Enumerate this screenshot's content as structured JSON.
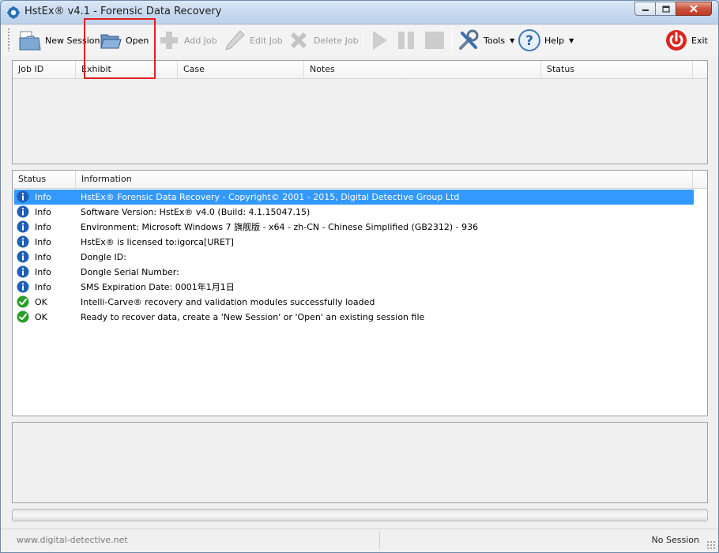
{
  "window": {
    "title": "HstEx® v4.1 - Forensic Data Recovery"
  },
  "toolbar": {
    "new_session": "New Session",
    "open": "Open",
    "add_job": "Add Job",
    "edit_job": "Edit Job",
    "delete_job": "Delete Job",
    "tools": "Tools",
    "help": "Help",
    "exit": "Exit"
  },
  "jobs_table": {
    "columns": [
      "Job ID",
      "Exhibit",
      "Case",
      "Notes",
      "Status"
    ]
  },
  "log_table": {
    "columns": [
      "Status",
      "Information"
    ],
    "rows": [
      {
        "status": "Info",
        "kind": "info",
        "text": "HstEx® Forensic Data Recovery - Copyright© 2001 - 2015, Digital Detective Group Ltd"
      },
      {
        "status": "Info",
        "kind": "info",
        "text": "Software Version: HstEx® v4.0 (Build: 4.1.15047.15)"
      },
      {
        "status": "Info",
        "kind": "info",
        "text": "Environment: Microsoft Windows 7 旗舰版 - x64 - zh-CN - Chinese Simplified (GB2312) - 936"
      },
      {
        "status": "Info",
        "kind": "info",
        "text": "HstEx® is licensed to:igorca[URET]"
      },
      {
        "status": "Info",
        "kind": "info",
        "text": "Dongle ID:"
      },
      {
        "status": "Info",
        "kind": "info",
        "text": "Dongle Serial Number:"
      },
      {
        "status": "Info",
        "kind": "info",
        "text": "SMS Expiration Date: 0001年1月1日"
      },
      {
        "status": "OK",
        "kind": "ok",
        "text": "Intelli-Carve® recovery and validation modules successfully loaded"
      },
      {
        "status": "OK",
        "kind": "ok",
        "text": "Ready to recover data, create a 'New Session' or 'Open' an existing session file"
      }
    ]
  },
  "progress": {
    "value": 0
  },
  "statusbar": {
    "website": "www.digital-detective.net",
    "session": "No Session"
  },
  "colors": {
    "selection": "#3399ff",
    "info_icon": "#1f5fb8",
    "ok_icon": "#2a9d2a",
    "exit_icon": "#d9261c",
    "highlight": "#e02020"
  },
  "icons": {
    "app": "gear-icon",
    "new_session": "new-session-icon",
    "open": "open-folder-icon",
    "add_job": "plus-icon",
    "edit_job": "pencil-icon",
    "delete_job": "x-icon",
    "play": "play-icon",
    "pause": "pause-icon",
    "stop": "stop-icon",
    "tools": "tools-icon",
    "help": "help-icon",
    "exit": "power-icon"
  }
}
